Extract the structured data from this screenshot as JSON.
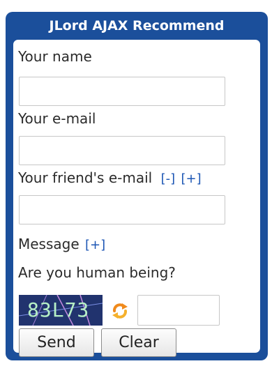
{
  "widget": {
    "title": "JLord AJAX Recommend"
  },
  "form": {
    "name_label": "Your name",
    "name_value": "",
    "email_label": "Your e-mail",
    "email_value": "",
    "friend_email_label": "Your friend's e-mail",
    "friend_email_value": "",
    "friend_less": "[-]",
    "friend_more": "[+]",
    "message_label": "Message",
    "message_more": "[+]",
    "human_label": "Are you human being?",
    "captcha_text": "83L73",
    "captcha_answer": "",
    "send_label": "Send",
    "clear_label": "Clear"
  },
  "icons": {
    "refresh": "refresh-icon"
  },
  "colors": {
    "frame": "#1b4f9b",
    "link": "#1c56b4",
    "captcha_bg": "#21336e",
    "captcha_text": "#b6f0c6"
  }
}
